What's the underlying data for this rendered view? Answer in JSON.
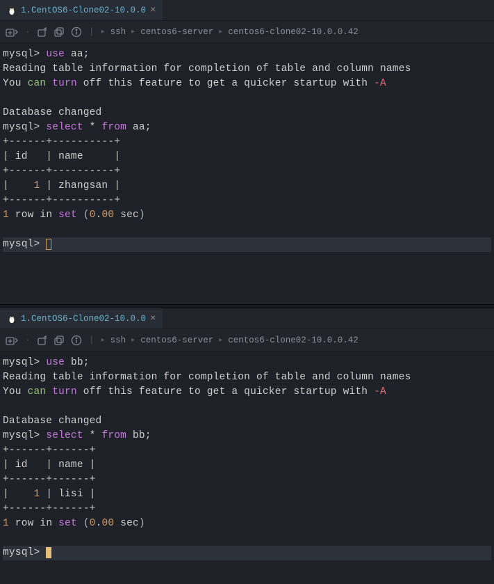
{
  "panes": [
    {
      "tab": {
        "title": "1.CentOS6-Clone02-10.0.0"
      },
      "breadcrumbs": [
        "ssh",
        "centos6-server",
        "centos6-clone02-10.0.0.42"
      ],
      "session": {
        "use_cmd": {
          "prompt": "mysql> ",
          "kw": "use",
          "db": "aa",
          "tail": ";"
        },
        "reading": "Reading table information for completion of table and column names",
        "off_line": {
          "p1": "You ",
          "can": "can",
          "sp": " ",
          "turn": "turn",
          "p2": " off this feature to get a quicker startup with ",
          "flag": "-A"
        },
        "changed": "Database changed",
        "select_cmd": {
          "prompt": "mysql> ",
          "select": "select",
          "star": " * ",
          "from": "from",
          "tbl": " aa",
          "tail": ";"
        },
        "border": "+------+----------+",
        "header": "| id   | name     |",
        "row": {
          "pre": "|    ",
          "num": "1",
          "rest": " | zhangsan |"
        },
        "result": {
          "n": "1",
          "txt1": " row ",
          "in": "in",
          "sp": " ",
          "set": "set",
          "sp2": " ",
          "lp": "(",
          "z1": "0",
          "dot": ".",
          "z2": "00",
          "sec": " sec",
          "rp": ")"
        },
        "prompt_end": "mysql> "
      }
    },
    {
      "tab": {
        "title": "1.CentOS6-Clone02-10.0.0"
      },
      "breadcrumbs": [
        "ssh",
        "centos6-server",
        "centos6-clone02-10.0.0.42"
      ],
      "session": {
        "use_cmd": {
          "prompt": "mysql> ",
          "kw": "use",
          "db": "bb",
          "tail": ";"
        },
        "reading": "Reading table information for completion of table and column names",
        "off_line": {
          "p1": "You ",
          "can": "can",
          "sp": " ",
          "turn": "turn",
          "p2": " off this feature to get a quicker startup with ",
          "flag": "-A"
        },
        "changed": "Database changed",
        "select_cmd": {
          "prompt": "mysql> ",
          "select": "select",
          "star": " * ",
          "from": "from",
          "tbl": " bb",
          "tail": ";"
        },
        "border": "+------+------+",
        "header": "| id   | name |",
        "row": {
          "pre": "|    ",
          "num": "1",
          "rest": " | lisi |"
        },
        "result": {
          "n": "1",
          "txt1": " row ",
          "in": "in",
          "sp": " ",
          "set": "set",
          "sp2": " ",
          "lp": "(",
          "z1": "0",
          "dot": ".",
          "z2": "00",
          "sec": " sec",
          "rp": ")"
        },
        "prompt_end": "mysql> "
      }
    }
  ]
}
